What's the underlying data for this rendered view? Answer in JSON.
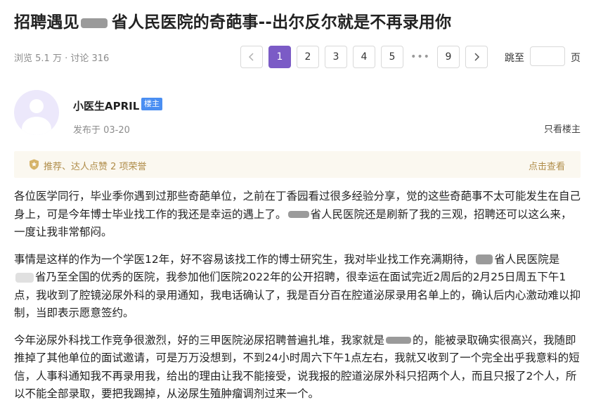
{
  "title": {
    "before": "招聘遇见",
    "after": "省人民医院的奇葩事--出尔反尔就是不再录用你"
  },
  "meta": {
    "views": "浏览 5.1 万",
    "sep": " · ",
    "comments": "讨论 316"
  },
  "pagination": {
    "prev_icon": "chevron-left-icon",
    "pages": [
      "1",
      "2",
      "3",
      "4",
      "5"
    ],
    "ellipsis": "•••",
    "last": "9",
    "next_icon": "chevron-right-icon",
    "current": "1",
    "jump_label": "跳至",
    "jump_value": "",
    "jump_unit": "页"
  },
  "author": {
    "name": "小医生APRIL",
    "badge": "楼主",
    "posted": "发布于 03-20",
    "only_op": "只看楼主"
  },
  "honor": {
    "icon": "medal-icon",
    "text": "推荐、达人点赞 2 项荣誉",
    "link": "点击查看",
    "color": "#b08d4a"
  },
  "content": {
    "p1a": "各位医学同行，毕业季你遇到过那些奇葩单位，之前在丁香园看过很多经验分享，觉的这些奇葩事不太可能发生在自己身上，可是今年博士毕业找工作的我还是幸运的遇上了。",
    "p1b": "省人民医院还是刷新了我的三观，招聘还可以这么来，一度让我非常郁闷。",
    "p2a": "事情是这样的作为一个学医12年，好不容易该找工作的博士研究生，我对毕业找工作充满期待，",
    "p2b": "省人民医院是",
    "p2c": "省乃至全国的优秀的医院，我参加他们医院2022年的公开招聘，很幸运在面试完近2周后的2月25日周五下午1点，我收到了腔镜泌尿外科的录用通知，我电话确认了，我是百分百在腔道泌尿录用名单上的，确认后内心激动难以抑制，当即表示愿意签约。",
    "p3a": "今年泌尿外科找工作竞争很激烈，好的三甲医院泌尿招聘普遍扎堆，我家就是",
    "p3b": "的，能被录取确实很高兴，我随即推掉了其他单位的面试邀请，可是万万没想到，不到24小时周六下午1点左右，我就又收到了一个完全出乎我意料的短信，人事科通知我不再录用我，给出的理由让我不能接受，说我报的腔道泌尿外科只招两个人，而且只报了2个人，所以不能全部录取，要把我踢掉，从泌尿生殖肿瘤调剂过来一个。"
  },
  "colors": {
    "accent": "#7b5bc6",
    "badge": "#4a8ef2",
    "honor_bg": "#fbf8f0"
  }
}
